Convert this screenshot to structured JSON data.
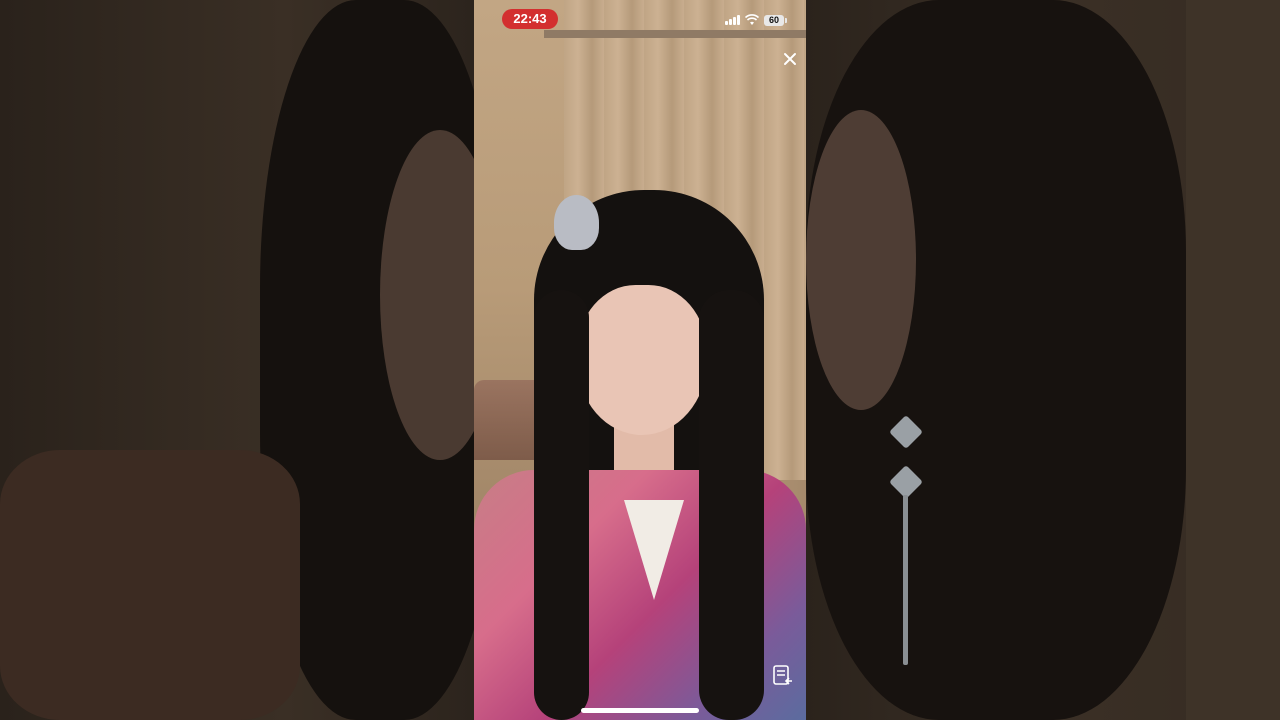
{
  "status_bar": {
    "time": "22:43",
    "battery": "60"
  },
  "icons": {
    "close": "close-icon",
    "pip": "picture-in-picture-icon",
    "signal": "signal-icon",
    "wifi": "wifi-icon",
    "battery": "battery-icon"
  }
}
